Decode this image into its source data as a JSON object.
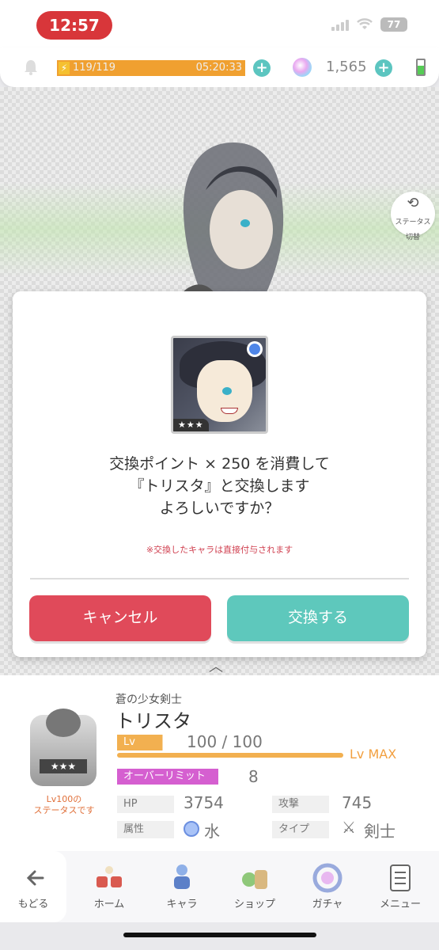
{
  "status_bar": {
    "time": "12:57",
    "battery": "77"
  },
  "resources": {
    "stamina": "119/119",
    "stamina_fraction": 1.0,
    "stamina_timer": "05:20:33",
    "gems": "1,565"
  },
  "status_toggle": {
    "label": "ステータス\n切替"
  },
  "dialog": {
    "portrait_stars": "★★★",
    "message_line1": "交換ポイント × 250 を消費して",
    "message_line2": "『トリスタ』と交換します",
    "message_line3": "よろしいですか？",
    "note": "※交換したキャラは直接付与されます",
    "cancel_label": "キャンセル",
    "confirm_label": "交換する"
  },
  "character": {
    "title": "蒼の少女剣士",
    "name": "トリスタ",
    "emblem_stars": "★★★",
    "level_note": "Lv100の\nステータスです",
    "lv_label": "Lv",
    "lv_value": "100 / 100",
    "lv_max": "Lv MAX",
    "overlimit_label": "オーバーリミット",
    "overlimit_value": "8",
    "hp_label": "HP",
    "hp_value": "3754",
    "attack_label": "攻撃",
    "attack_value": "745",
    "attribute_label": "属性",
    "attribute_value": "水",
    "type_label": "タイプ",
    "type_value": "剣士"
  },
  "nav": {
    "back": "もどる",
    "home": "ホーム",
    "chara": "キャラ",
    "shop": "ショップ",
    "gacha": "ガチャ",
    "menu": "メニュー"
  },
  "colors": {
    "cancel": "#e04a5a",
    "confirm": "#5ec8bc",
    "accent_orange": "#f2b050",
    "accent_magenta": "#d55fd0",
    "time_pill": "#d8363a"
  }
}
